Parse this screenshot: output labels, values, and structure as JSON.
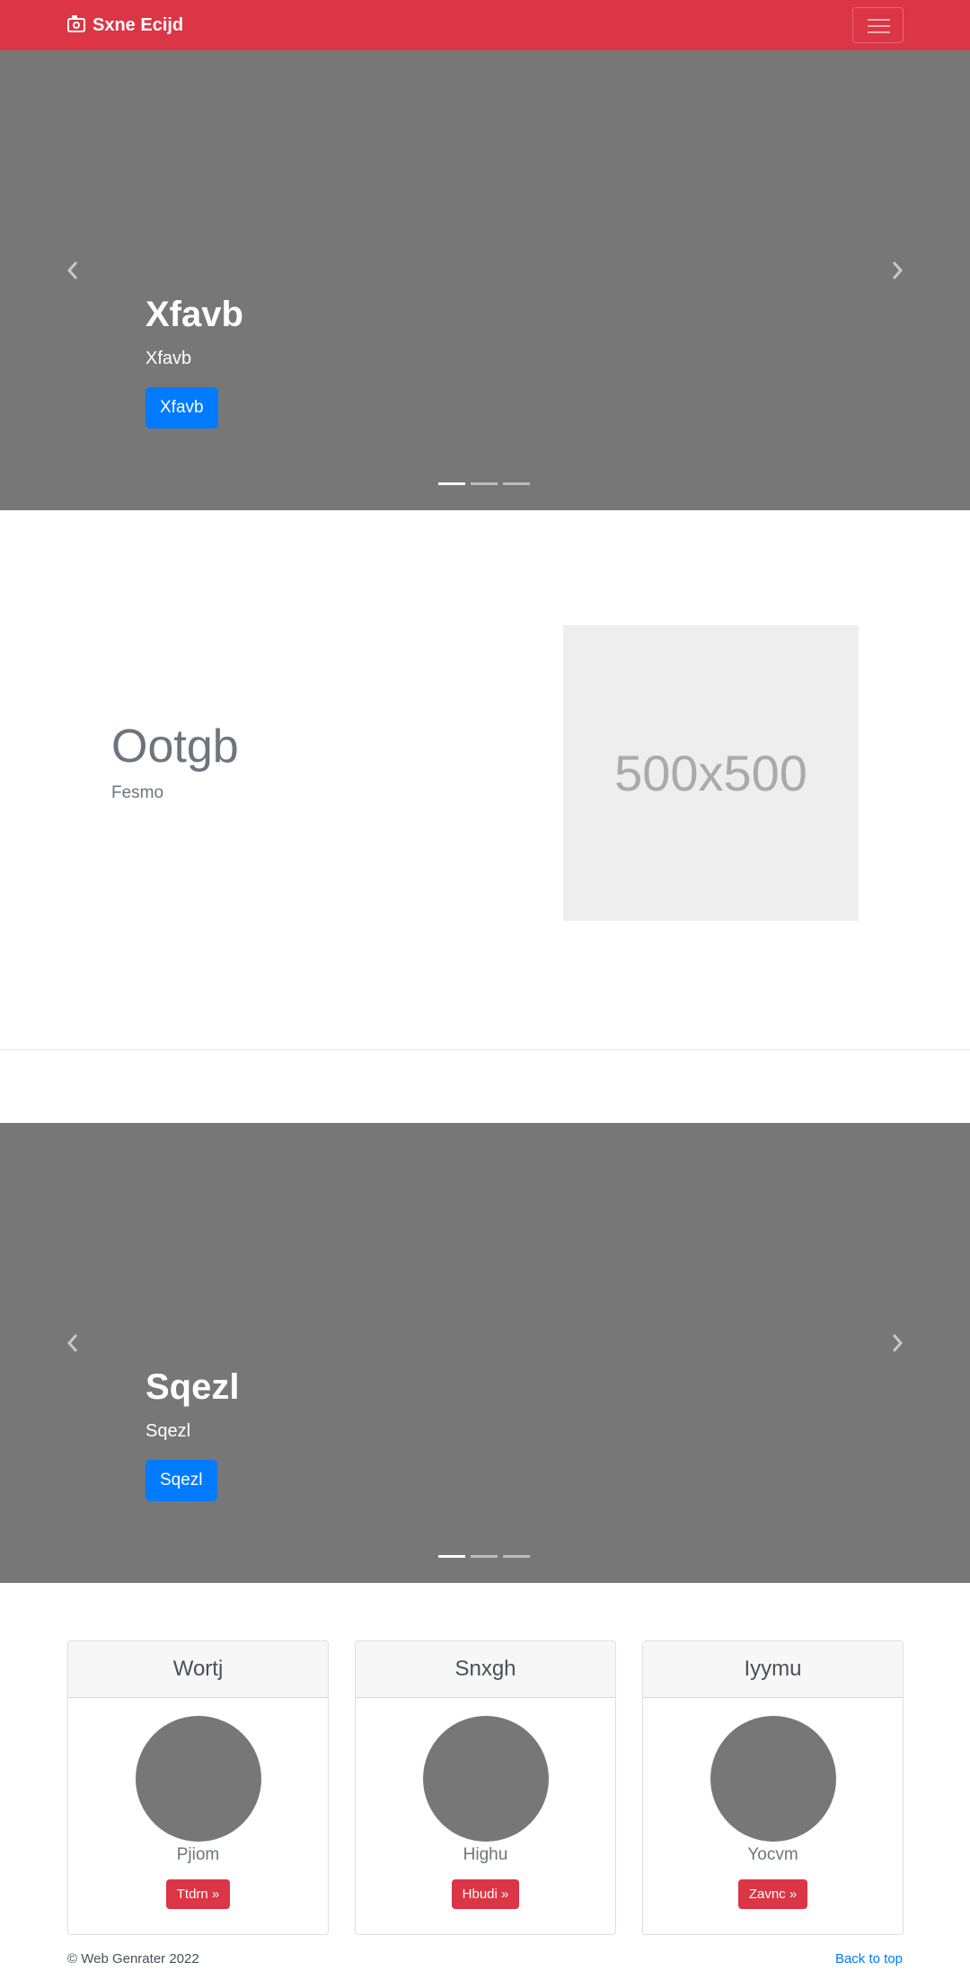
{
  "navbar": {
    "brand": "Sxne Ecijd",
    "brand_icon": "camera-icon",
    "toggler_icon": "hamburger-menu-icon",
    "background": "#dc3545"
  },
  "carousel1": {
    "heading": "Xfavb",
    "text": "Xfavb",
    "button": "Xfavb",
    "slides": 3,
    "active_slide": 1
  },
  "featurette": {
    "heading": "Ootgb",
    "lead": "Fesmo",
    "image_placeholder": "500x500"
  },
  "carousel2": {
    "heading": "Sqezl",
    "text": "Sqezl",
    "button": "Sqezl",
    "slides": 3,
    "active_slide": 1
  },
  "cards": [
    {
      "title": "Wortj",
      "name": "Pjiom",
      "button": "Ttdrn »"
    },
    {
      "title": "Snxgh",
      "name": "Highu",
      "button": "Hbudi »"
    },
    {
      "title": "Iyymu",
      "name": "Yocvm",
      "button": "Zavnc »"
    }
  ],
  "footer": {
    "copyright": "© Web Genrater 2022",
    "back_to_top": "Back to top"
  },
  "colors": {
    "primary": "#007bff",
    "danger": "#dc3545",
    "carousel_bg": "#777777"
  }
}
